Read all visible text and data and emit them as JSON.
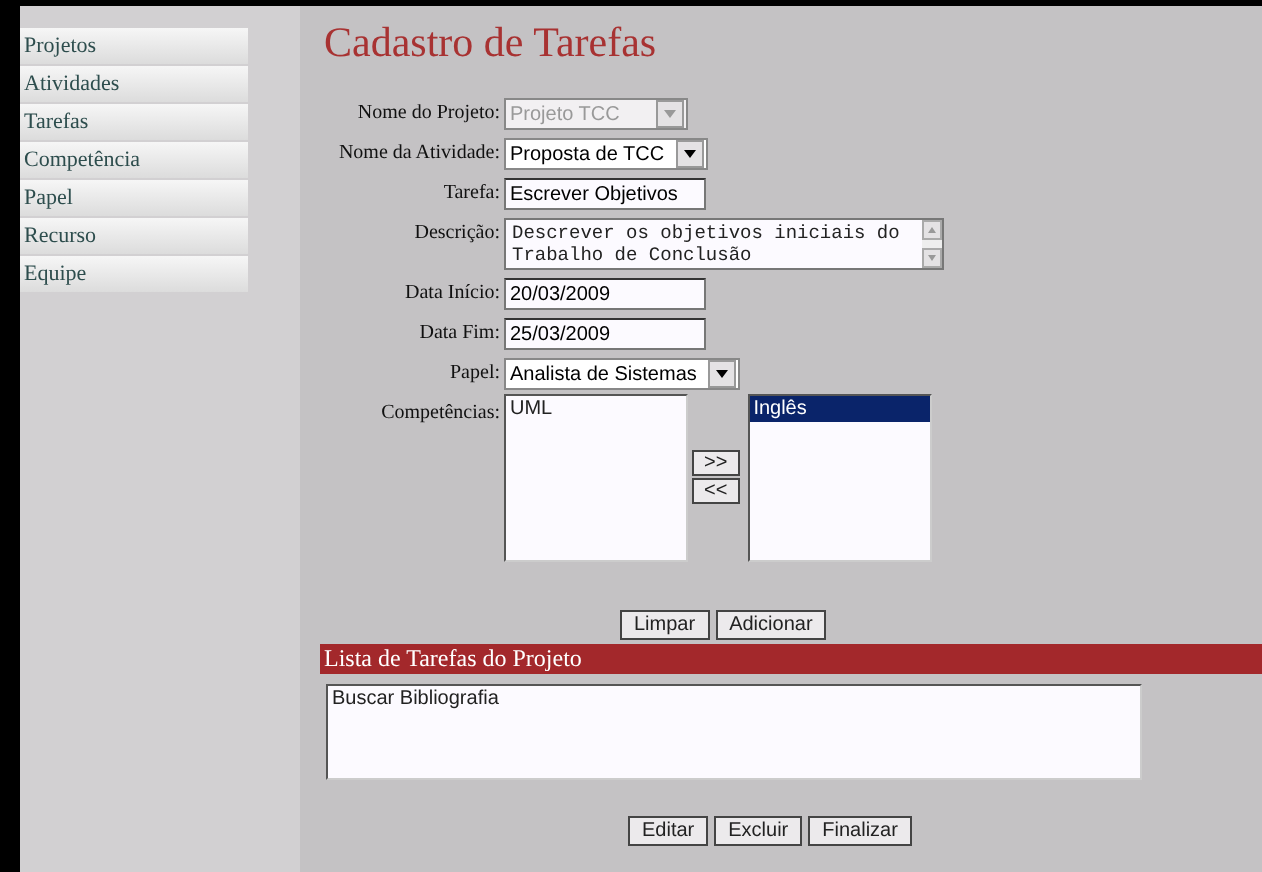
{
  "sidebar": {
    "items": [
      {
        "label": "Projetos"
      },
      {
        "label": "Atividades"
      },
      {
        "label": "Tarefas"
      },
      {
        "label": "Competência"
      },
      {
        "label": "Papel"
      },
      {
        "label": "Recurso"
      },
      {
        "label": "Equipe"
      }
    ]
  },
  "title": "Cadastro de Tarefas",
  "form": {
    "fields": [
      {
        "kind": "select",
        "label": "Nome do Projeto:",
        "value": "Projeto TCC",
        "disabled": true
      },
      {
        "kind": "select",
        "label": "Nome da Atividade:",
        "value": "Proposta de TCC",
        "disabled": false
      },
      {
        "kind": "text",
        "label": "Tarefa:",
        "value": "Escrever Objetivos"
      },
      {
        "kind": "textarea",
        "label": "Descrição:",
        "value": "Descrever os objetivos iniciais do Trabalho de Conclusão"
      },
      {
        "kind": "text",
        "label": "Data Início:",
        "value": "20/03/2009"
      },
      {
        "kind": "text",
        "label": "Data Fim:",
        "value": "25/03/2009"
      },
      {
        "kind": "select",
        "label": "Papel:",
        "value": "Analista de Sistemas",
        "disabled": false
      }
    ],
    "competencias": {
      "label": "Competências:",
      "available": [
        {
          "label": "UML",
          "selected": false
        }
      ],
      "move_buttons": [
        ">>",
        "<<"
      ],
      "chosen": [
        {
          "label": "Inglês",
          "selected": true
        }
      ]
    },
    "buttons": [
      "Limpar",
      "Adicionar"
    ]
  },
  "task_list": {
    "title": "Lista de Tarefas do Projeto",
    "items": [
      {
        "label": "Buscar Bibliografia",
        "selected": false
      }
    ],
    "buttons": [
      "Editar",
      "Excluir",
      "Finalizar"
    ]
  }
}
